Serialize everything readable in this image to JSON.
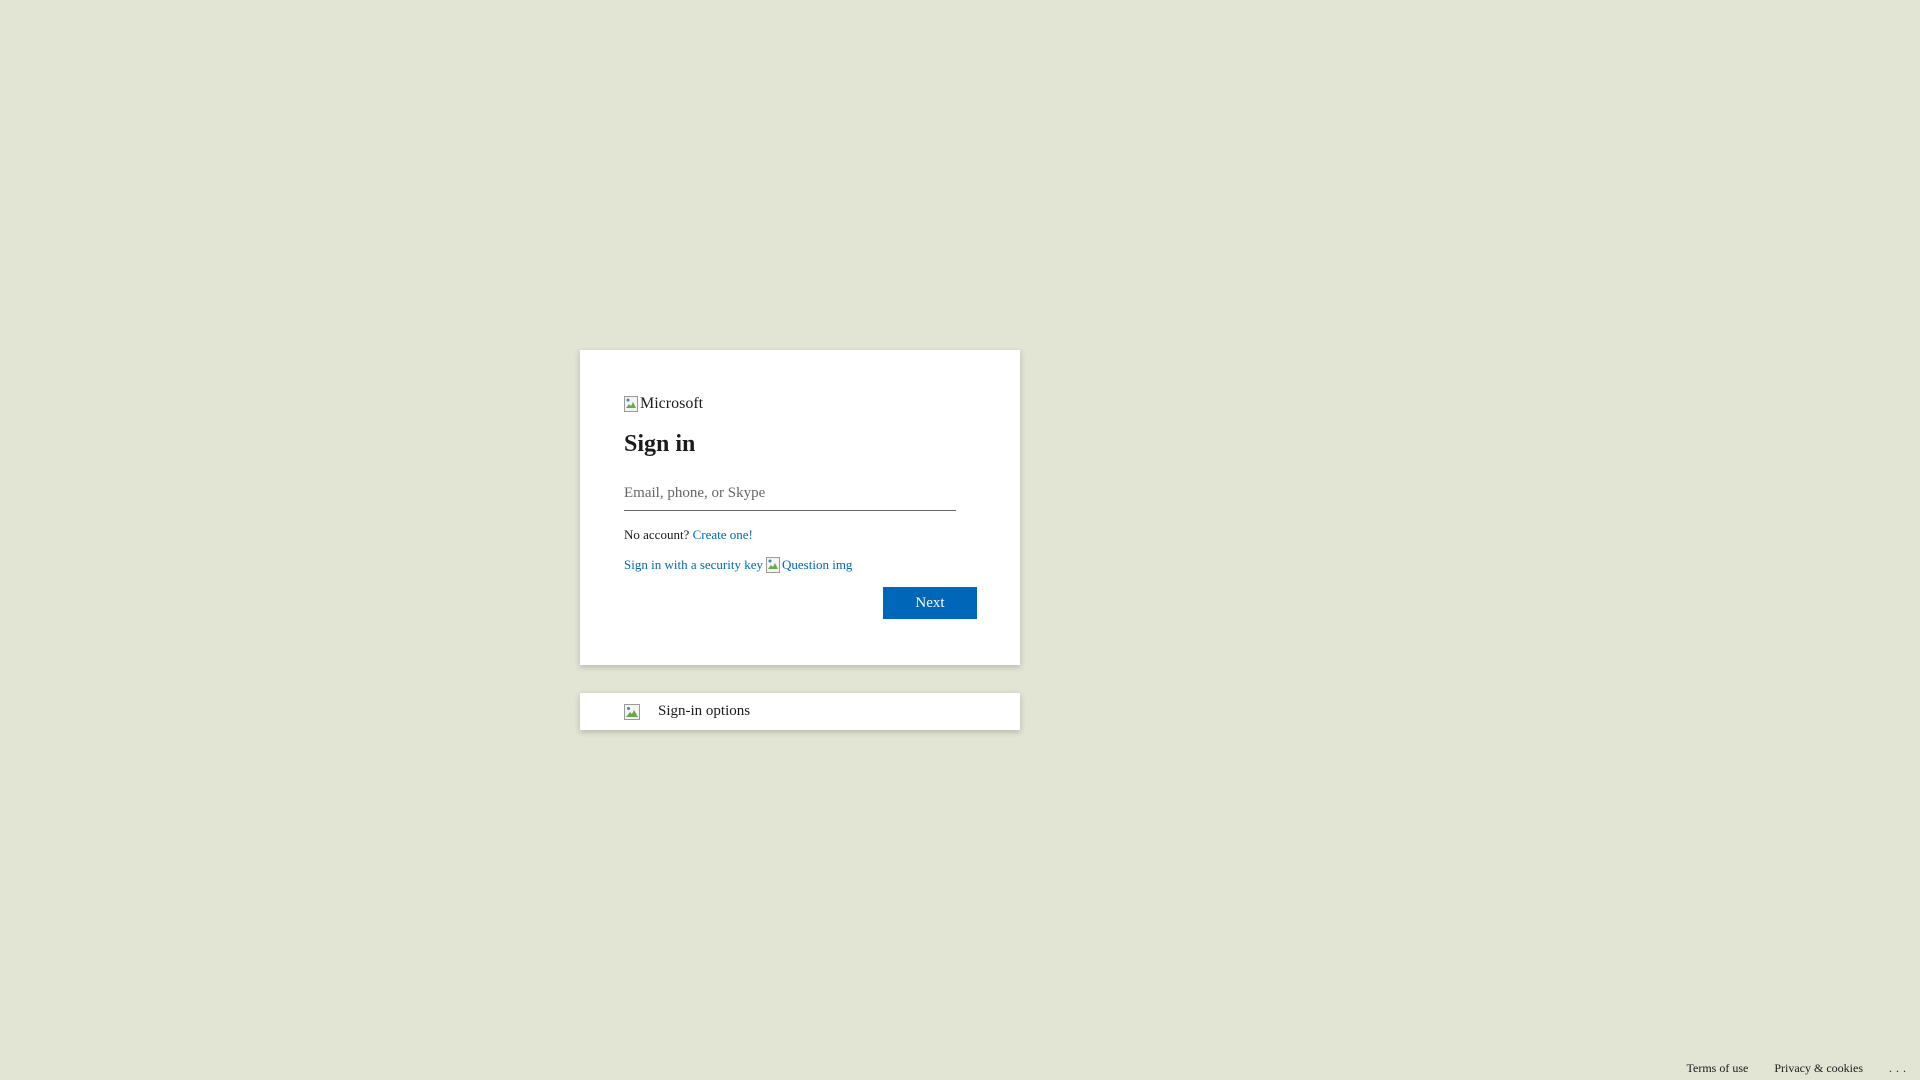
{
  "card": {
    "logo_alt": "Microsoft",
    "logo_icon": "broken-image-icon",
    "title": "Sign in",
    "email_placeholder": "Email, phone, or Skype",
    "email_value": "",
    "no_account_text": "No account?",
    "create_link": "Create one!",
    "security_key_link": "Sign in with a security key",
    "question_alt": "Question img",
    "next_label": "Next"
  },
  "signin_options": {
    "icon": "broken-image-icon",
    "label": "Sign-in options"
  },
  "footer": {
    "terms": "Terms of use",
    "privacy": "Privacy & cookies",
    "more": "..."
  },
  "colors": {
    "background": "#e2e4d4",
    "accent": "#0067b8",
    "card": "#ffffff",
    "text": "#1b1b1b"
  }
}
